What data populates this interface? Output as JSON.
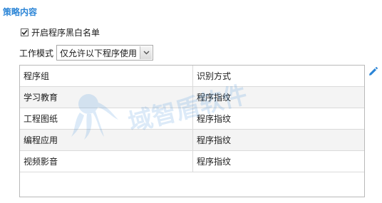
{
  "section": {
    "title": "策略内容"
  },
  "whitelist": {
    "checked": true,
    "label": "开启程序黑白名单"
  },
  "mode": {
    "label": "工作模式",
    "selected": "仅允许以下程序使用"
  },
  "table": {
    "columns": [
      "程序组",
      "识别方式"
    ],
    "rows": [
      {
        "group": "学习教育",
        "method": "程序指纹"
      },
      {
        "group": "工程图纸",
        "method": "程序指纹"
      },
      {
        "group": "编程应用",
        "method": "程序指纹"
      },
      {
        "group": "视频影音",
        "method": "程序指纹"
      }
    ]
  },
  "watermark": {
    "text": "域智盾软件"
  },
  "colors": {
    "accent": "#2a84d6",
    "row_alt": "#f4f4f4",
    "border": "#b9b9b9"
  },
  "icons": {
    "edit": "pencil-icon",
    "dropdown": "chevron-down-icon",
    "check": "checkmark-icon"
  }
}
